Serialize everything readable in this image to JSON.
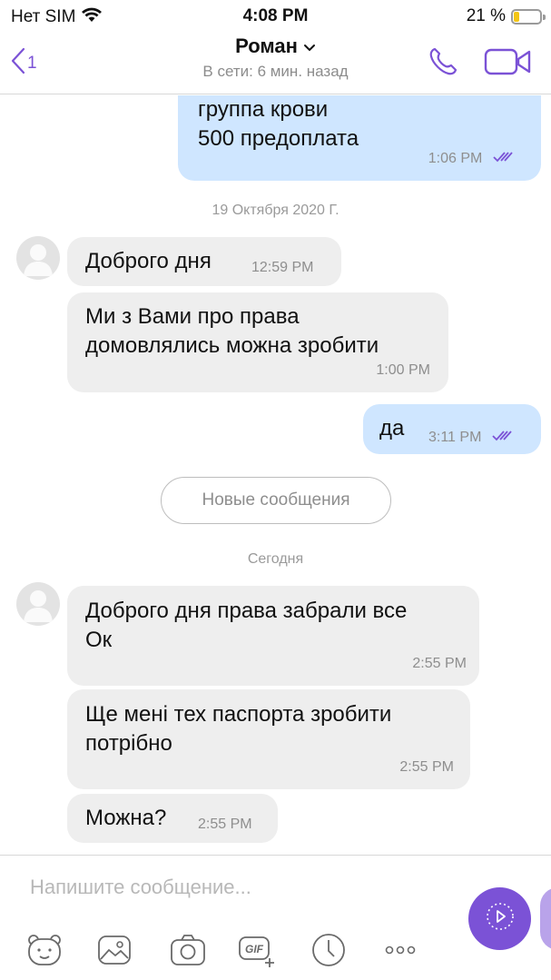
{
  "status_bar": {
    "carrier": "Нет SIM",
    "time": "4:08 PM",
    "battery": "21 %",
    "battery_level": 0.21
  },
  "header": {
    "back_count": "1",
    "contact_name": "Роман",
    "contact_status": "В сети: 6 мин. назад"
  },
  "messages": {
    "m1": {
      "lines": [
        "группа крови",
        "500 предоплата"
      ],
      "time": "1:06 PM"
    },
    "date1": "19 Октября 2020 Г.",
    "m2": {
      "text": "Доброго дня",
      "time": "12:59 PM"
    },
    "m3": {
      "lines": [
        "Ми з Вами про права",
        "домовлялись можна зробити"
      ],
      "time": "1:00 PM"
    },
    "m4": {
      "text": "да",
      "time": "3:11 PM"
    },
    "new_messages": "Новые сообщения",
    "date2": "Сегодня",
    "m5": {
      "lines": [
        "Доброго дня права забрали все",
        "Ок"
      ],
      "time": "2:55 PM"
    },
    "m6": {
      "lines": [
        "Ще мені тех паспорта зробити",
        "потрібно"
      ],
      "time": "2:55 PM"
    },
    "m7": {
      "text": "Можна?",
      "time": "2:55 PM"
    }
  },
  "composer": {
    "placeholder": "Напишите сообщение..."
  },
  "colors": {
    "accent": "#7b52d6",
    "outgoing_bubble": "#cfe6ff",
    "incoming_bubble": "#eeeeee"
  },
  "icons": [
    "back-icon",
    "wifi-icon",
    "battery-icon",
    "chevron-down-icon",
    "phone-icon",
    "video-icon",
    "sticker-icon",
    "gallery-icon",
    "camera-icon",
    "gif-icon",
    "timer-icon",
    "more-icon",
    "send-icon"
  ]
}
